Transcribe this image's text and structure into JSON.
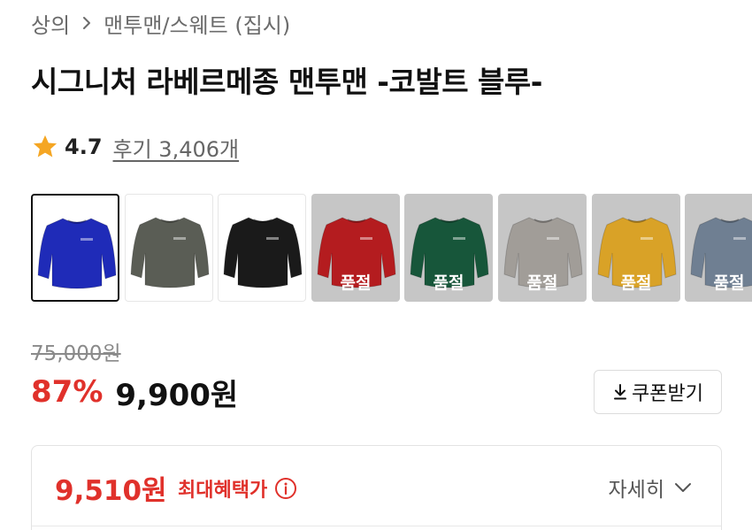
{
  "breadcrumb": {
    "items": [
      "상의",
      "맨투맨/스웨트 (집시)"
    ],
    "icons": {
      "separator": "chevron-right-icon"
    }
  },
  "product": {
    "title": "시그니처 라베르메종 맨투맨 -코발트 블루-"
  },
  "rating": {
    "score": "4.7",
    "review_link": "후기 3,406개",
    "icon": "star-icon",
    "star_color": "#f5a623"
  },
  "colors": {
    "sold_out_label": "품절",
    "options": [
      {
        "color": "#1f2bb8",
        "state": "selected"
      },
      {
        "color": "#5a5d55",
        "state": "available"
      },
      {
        "color": "#1a1a1a",
        "state": "available"
      },
      {
        "color": "#b41c1f",
        "state": "soldout"
      },
      {
        "color": "#17563a",
        "state": "soldout"
      },
      {
        "color": "#a19d98",
        "state": "soldout"
      },
      {
        "color": "#d9a227",
        "state": "soldout"
      },
      {
        "color": "#6f7f92",
        "state": "soldout"
      }
    ]
  },
  "pricing": {
    "original_price": "75,000원",
    "discount_rate": "87%",
    "sale_price": "9,900원",
    "coupon_button": "쿠폰받기",
    "coupon_icon": "download-icon",
    "discount_color": "#e0312b"
  },
  "benefit": {
    "max_price": "9,510원",
    "label": "최대혜택가",
    "info_icon": "info-icon",
    "detail_toggle": "자세히",
    "toggle_icon": "chevron-down-icon"
  }
}
